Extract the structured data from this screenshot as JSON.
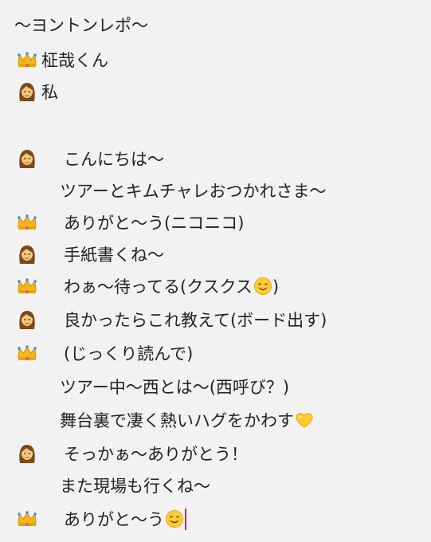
{
  "note": {
    "title": "〜ヨントンレポ〜",
    "legend": [
      {
        "icon": "crown-emoji",
        "label": "柾哉くん"
      },
      {
        "icon": "woman-emoji",
        "label": "私"
      }
    ],
    "lines": [
      {
        "speaker": "woman-emoji",
        "text": "こんにちは〜"
      },
      {
        "speaker": "",
        "text": "ツアーとキムチャレおつかれさま〜"
      },
      {
        "speaker": "crown-emoji",
        "text": "ありがと〜う(ニコニコ)"
      },
      {
        "speaker": "woman-emoji",
        "text": "手紙書くね〜"
      },
      {
        "speaker": "crown-emoji",
        "text": "わぁ〜待ってる(クスクス",
        "trail_emoji": "smiling-face-emoji",
        "trail_text": ")"
      },
      {
        "speaker": "woman-emoji",
        "text": "良かったらこれ教えて(ボード出す)"
      },
      {
        "speaker": "crown-emoji",
        "text": "(じっくり読んで)"
      },
      {
        "speaker": "",
        "text": "ツアー中〜西とは〜(西呼び？)"
      },
      {
        "speaker": "",
        "text": "舞台裏で凄く熱いハグをかわす",
        "trail_emoji": "yellow-heart-emoji"
      },
      {
        "speaker": "woman-emoji",
        "text": "そっかぁ〜ありがとう！"
      },
      {
        "speaker": "",
        "text": "また現場も行くね〜"
      },
      {
        "speaker": "crown-emoji",
        "text": "ありがと〜う",
        "trail_emoji": "smiling-face-emoji",
        "cursor": true
      }
    ]
  }
}
